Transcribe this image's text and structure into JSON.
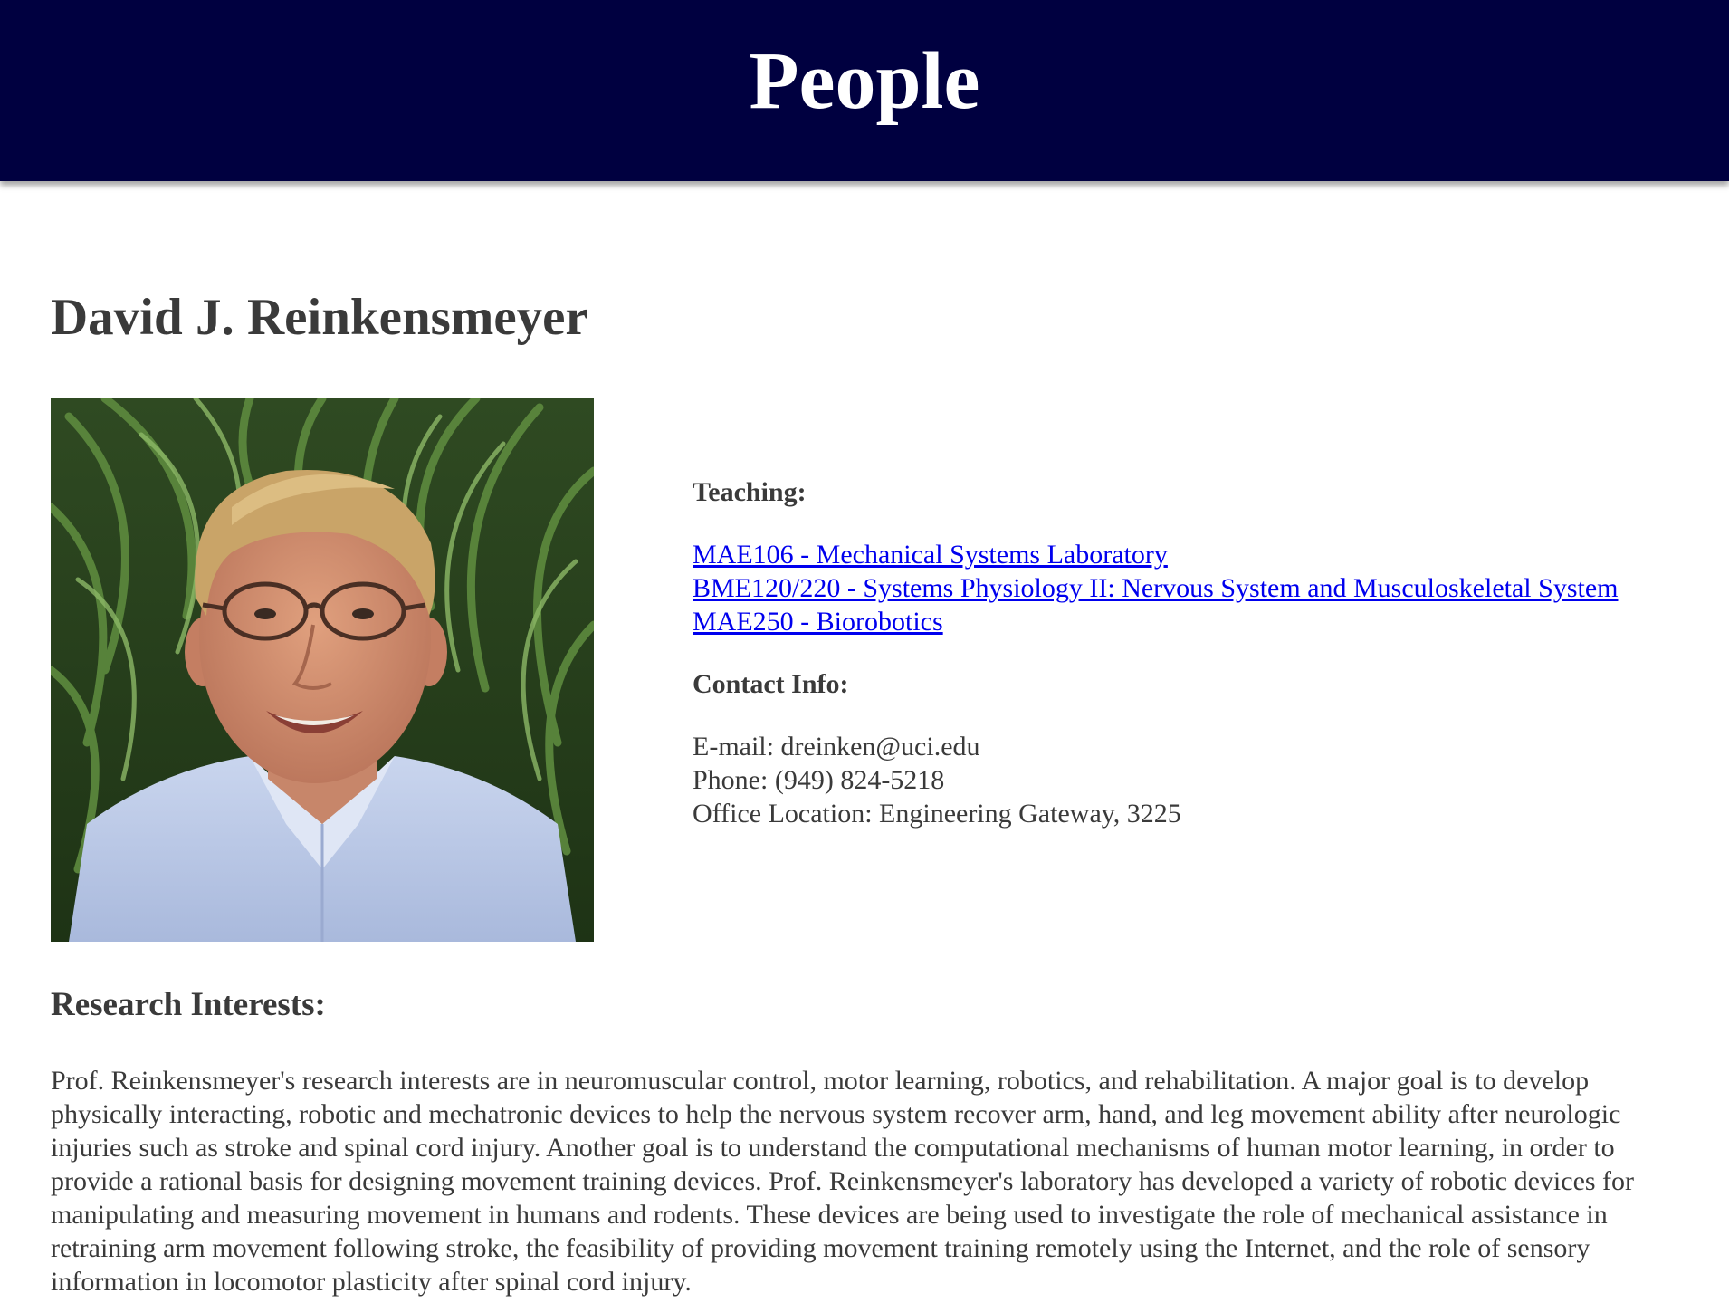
{
  "header": {
    "title": "People"
  },
  "person": {
    "name": "David J. Reinkensmeyer",
    "photo_alt": "photo-of-david-j-reinkensmeyer"
  },
  "teaching": {
    "label": "Teaching:",
    "courses": [
      {
        "label": "MAE106 - Mechanical Systems Laboratory"
      },
      {
        "label": "BME120/220 - Systems Physiology II: Nervous System and Musculoskeletal System"
      },
      {
        "label": "MAE250 - Biorobotics"
      }
    ]
  },
  "contact": {
    "label": "Contact Info:",
    "email": "E-mail: dreinken@uci.edu",
    "phone": "Phone: (949) 824-5218",
    "office": "Office Location: Engineering Gateway, 3225"
  },
  "research": {
    "title": "Research Interests:",
    "body": "Prof. Reinkensmeyer's research interests are in neuromuscular control, motor learning, robotics, and rehabilitation. A major goal is to develop physically interacting, robotic and mechatronic devices to help the nervous system recover arm, hand, and leg movement ability after neurologic injuries such as stroke and spinal cord injury. Another goal is to understand the computational mechanisms of human motor learning, in order to provide a rational basis for designing movement training devices. Prof. Reinkensmeyer's laboratory has developed a variety of robotic devices for manipulating and measuring movement in humans and rodents. These devices are being used to investigate the role of mechanical assistance in retraining arm movement following stroke, the feasibility of providing movement training remotely using the Internet, and the role of sensory information in locomotor plasticity after spinal cord injury."
  },
  "colors": {
    "banner": "#000040",
    "link": "#0000ee",
    "text": "#3a3a3a"
  }
}
